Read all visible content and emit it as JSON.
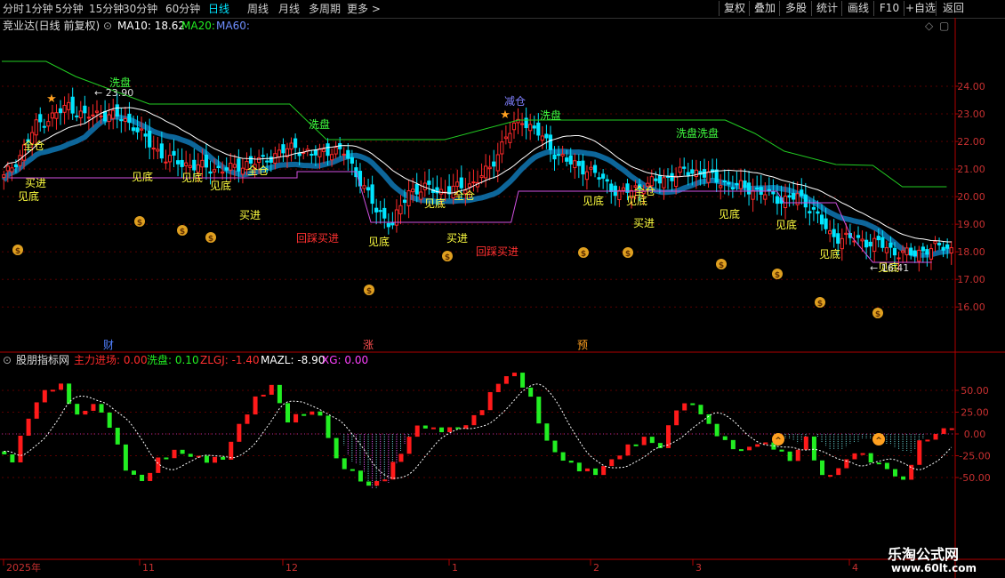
{
  "toolbar": {
    "periods": [
      "分时",
      "1分钟",
      "5分钟",
      "15分钟",
      "30分钟",
      "60分钟",
      "日线",
      "周线",
      "月线",
      "多周期",
      "更多"
    ],
    "active_period": "日线",
    "buttons": [
      "复权",
      "叠加",
      "多股",
      "统计",
      "画线",
      "F10",
      "+自选",
      "返回"
    ]
  },
  "main_panel": {
    "title": "竞业达(日线 前复权)",
    "ma10": "MA10: 18.62",
    "ma20": "MA20:",
    "ma60": "MA60:",
    "price_ticks": [
      "24.00",
      "23.00",
      "22.00",
      "21.00",
      "20.00",
      "19.00",
      "18.00",
      "17.00",
      "16.00"
    ],
    "high_label": "23.90",
    "low_label": "16.41",
    "signals": {
      "wash": "洗盘",
      "reduce": "减仓",
      "full": "全仓",
      "bottom": "见底",
      "buy": "买进",
      "pullback_buy": "回踩买进",
      "wash_double": "洗盘洗盘"
    },
    "event_markers": [
      "财",
      "涨",
      "预"
    ]
  },
  "indicator_panel": {
    "name": "股朋指标网",
    "main_force": "主力进场: 0.00",
    "wash": "洗盘: 0.10",
    "zlgj": "ZLGJ: -1.40",
    "mazl": "MAZL: -8.90",
    "xg": "XG: 0.00",
    "ticks": [
      "50.00",
      "25.00",
      "0.00",
      "-25.00",
      "-50.00"
    ]
  },
  "time_axis": [
    "2025年",
    "11",
    "12",
    "1",
    "2",
    "3",
    "4"
  ],
  "watermark": {
    "line1": "乐淘公式网",
    "line2": "www.60lt.com"
  },
  "colors": {
    "up": "#ff2a2a",
    "down": "#00e5ff",
    "ma_white": "#ffffff",
    "wash_line": "#22cc22",
    "support_line": "#d050e0",
    "ribbon_pink": "#ff40ff",
    "ribbon_blue": "#1080c0",
    "indicator_red": "#ff1a1a",
    "indicator_green": "#22ee22",
    "axis": "#b00000",
    "signal_yellow": "#ffff40",
    "signal_green": "#40ff40",
    "signal_red": "#ff3030"
  }
}
